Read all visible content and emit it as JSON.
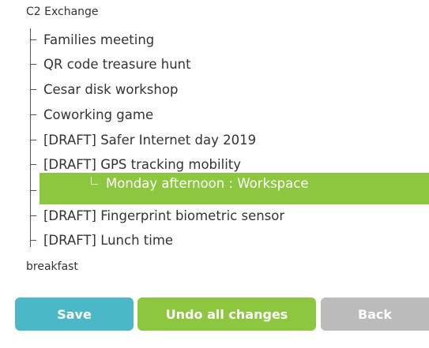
{
  "tree": {
    "root_label": "C2 Exchange",
    "items": [
      {
        "label": "Families meeting"
      },
      {
        "label": "QR code treasure hunt"
      },
      {
        "label": "Cesar disk workshop"
      },
      {
        "label": "Coworking game"
      },
      {
        "label": "[DRAFT] Safer Internet day 2019"
      },
      {
        "label": "[DRAFT] GPS tracking mobility"
      },
      {
        "label": "Monday afternoon : Workspace"
      },
      {
        "label": "[DRAFT] Fingerprint biometric sensor"
      },
      {
        "label": "[DRAFT] Lunch time"
      }
    ],
    "bottom_label": "breakfast"
  },
  "actions": {
    "save_label": "Save",
    "undo_label": "Undo all changes",
    "back_label": "Back"
  },
  "colors": {
    "save": "#4bb8c8",
    "undo": "#8dc63f",
    "back": "#bbbbbb",
    "highlight": "#8dc63f"
  }
}
